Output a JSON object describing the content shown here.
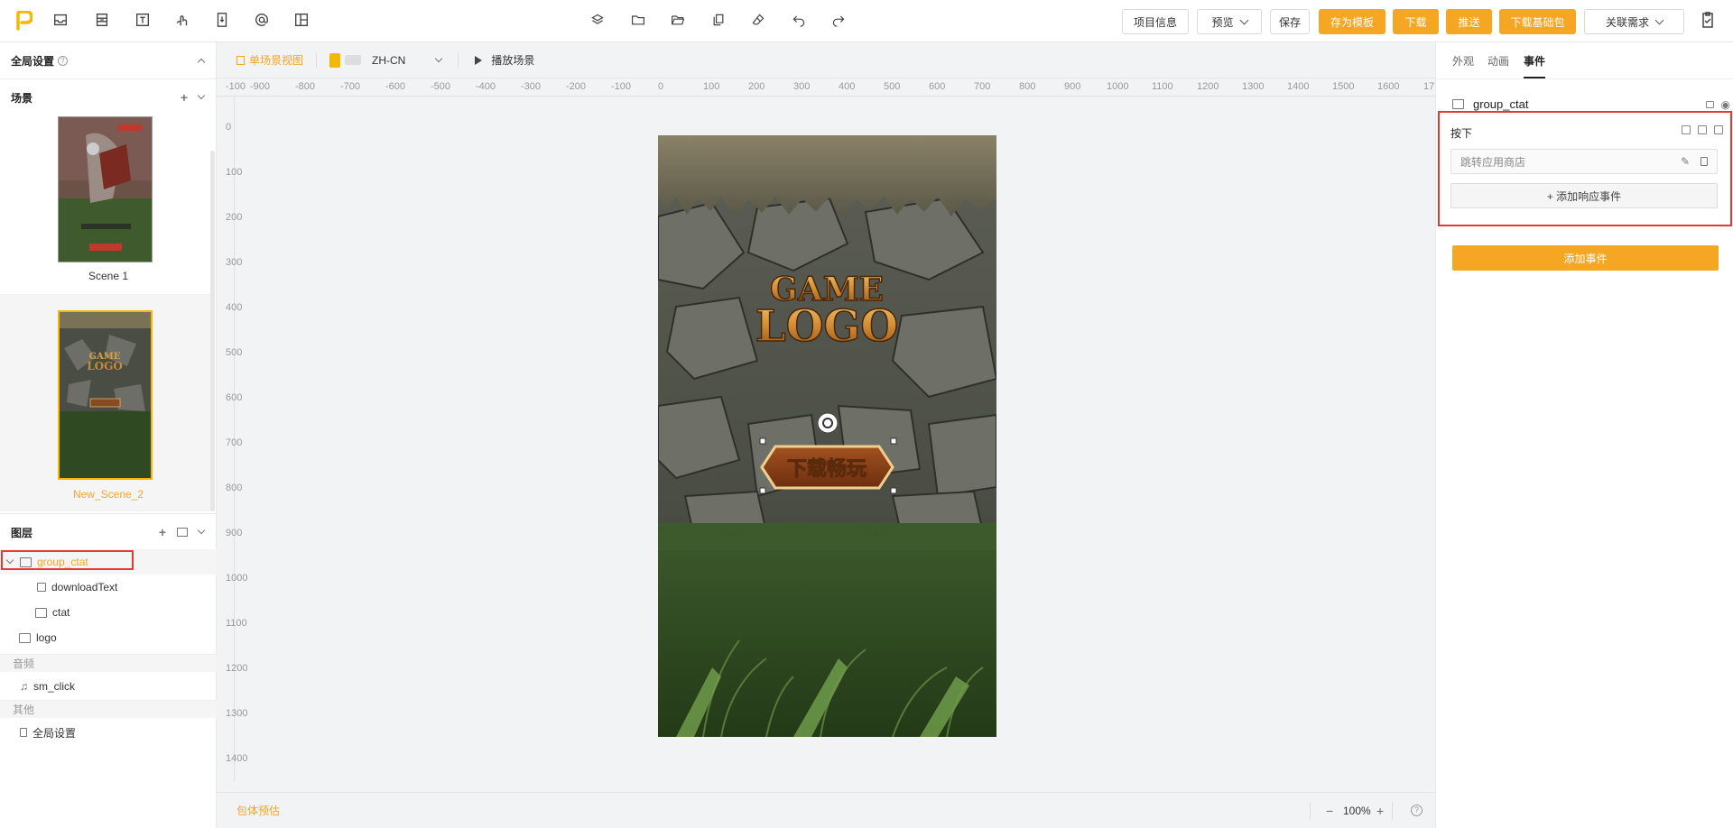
{
  "toolbar": {
    "project_info": "项目信息",
    "preview": "预览",
    "save": "保存",
    "save_as_template": "存为模板",
    "download": "下载",
    "push": "推送",
    "download_base": "下载基础包",
    "related_demand": "关联需求"
  },
  "left": {
    "global_settings": "全局设置",
    "scenes_title": "场景",
    "scenes": [
      {
        "label": "Scene 1"
      },
      {
        "label": "New_Scene_2"
      }
    ],
    "layers_title": "图层",
    "layers": [
      {
        "label": "group_ctat"
      },
      {
        "label": "downloadText"
      },
      {
        "label": "ctat"
      },
      {
        "label": "logo"
      }
    ],
    "audio_group": "音频",
    "audio_item": "sm_click",
    "other_group": "其他",
    "other_item": "全局设置"
  },
  "canvas": {
    "view_mode": "单场景视图",
    "language": "ZH-CN",
    "play_scene": "播放场景",
    "ruler_h": [
      "-100",
      "-900",
      "-800",
      "-700",
      "-600",
      "-500",
      "-400",
      "-300",
      "-200",
      "-100",
      "0",
      "100",
      "200",
      "300",
      "400",
      "500",
      "600",
      "700",
      "800",
      "900",
      "1000",
      "1100",
      "1200",
      "1300",
      "1400",
      "1500",
      "1600",
      "17"
    ],
    "ruler_v": [
      "0",
      "100",
      "200",
      "300",
      "400",
      "500",
      "600",
      "700",
      "800",
      "900",
      "1000",
      "1100",
      "1200",
      "1300",
      "1400"
    ],
    "package_estimate": "包体预估",
    "zoom": "100%",
    "zoom_minus": "−",
    "zoom_plus": "+",
    "help": "?",
    "game_logo_line1": "GAME",
    "game_logo_line2": "LOGO",
    "cta_text": "下载畅玩"
  },
  "right": {
    "tabs": [
      "外观",
      "动画",
      "事件"
    ],
    "active_tab": 2,
    "object_name": "group_ctat",
    "event_title": "按下",
    "action_label": "跳转应用商店",
    "add_response": "+ 添加响应事件",
    "add_event": "添加事件"
  },
  "colors": {
    "accent": "#f5a623",
    "highlight_red": "#e53935"
  }
}
